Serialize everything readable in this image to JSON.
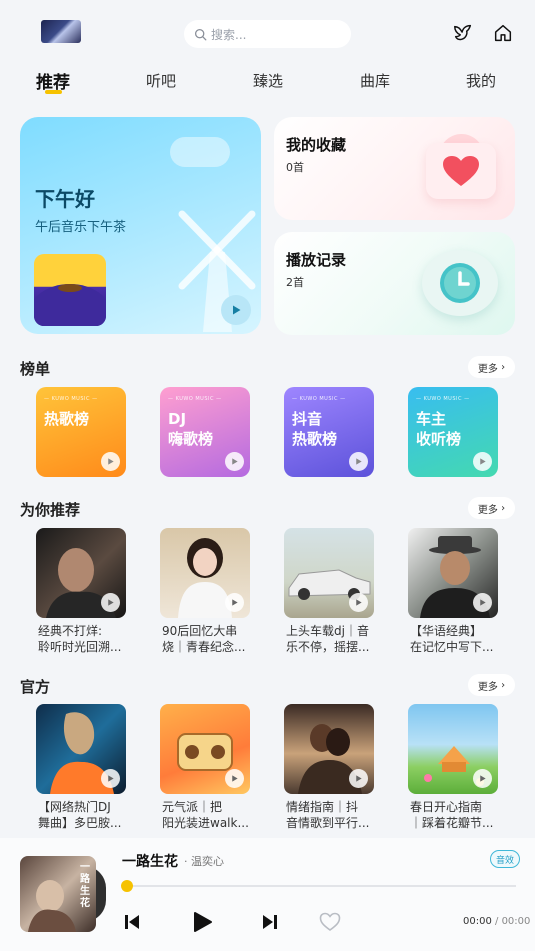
{
  "header": {
    "search_placeholder": "搜索...",
    "icons": [
      "thumbnail-image",
      "bird-icon",
      "home-icon"
    ]
  },
  "tabs": [
    {
      "label": "推荐",
      "active": true
    },
    {
      "label": "听吧",
      "active": false
    },
    {
      "label": "臻选",
      "active": false
    },
    {
      "label": "曲库",
      "active": false
    },
    {
      "label": "我的",
      "active": false
    }
  ],
  "hero": {
    "greeting": "下午好",
    "subtitle": "午后音乐下午茶"
  },
  "favorites": {
    "title": "我的收藏",
    "count": "0首"
  },
  "history": {
    "title": "播放记录",
    "count": "2首"
  },
  "charts": {
    "title": "榜单",
    "more": "更多",
    "brand": "— KUWO MUSIC —",
    "items": [
      {
        "name": "热歌榜",
        "colors": [
          "#ffb020",
          "#ff8a1a"
        ]
      },
      {
        "name": "DJ\n嗨歌榜",
        "colors": [
          "#ff8bc6",
          "#b066e0"
        ]
      },
      {
        "name": "抖音\n热歌榜",
        "colors": [
          "#8f7bff",
          "#5a4fd8"
        ]
      },
      {
        "name": "车主\n收听榜",
        "colors": [
          "#36c6e8",
          "#3fd3b0"
        ]
      }
    ]
  },
  "recommend": {
    "title": "为你推荐",
    "more": "更多",
    "items": [
      {
        "line1": "经典不打烊:",
        "line2": "聆听时光回溯..."
      },
      {
        "line1": "90后回忆大串",
        "line2": "烧｜青春纪念..."
      },
      {
        "line1": "上头车载dj｜音",
        "line2": "乐不停，摇摆..."
      },
      {
        "line1": "【华语经典】",
        "line2": "在记忆中写下..."
      }
    ]
  },
  "official": {
    "title": "官方",
    "more": "更多",
    "items": [
      {
        "line1": "【网络热门DJ",
        "line2": "舞曲】多巴胺..."
      },
      {
        "line1": "元气派｜把",
        "line2": "阳光装进walk..."
      },
      {
        "line1": "情绪指南｜抖",
        "line2": "音情歌到平行..."
      },
      {
        "line1": "春日开心指南",
        "line2": "｜踩着花瓣节..."
      }
    ]
  },
  "player": {
    "song": "一路生花",
    "artist": "· 温奕心",
    "effect": "音效",
    "current_time": "00:00",
    "separator": " / ",
    "total_time": "00:00",
    "progress": 0,
    "cover_text": "一路生花"
  }
}
